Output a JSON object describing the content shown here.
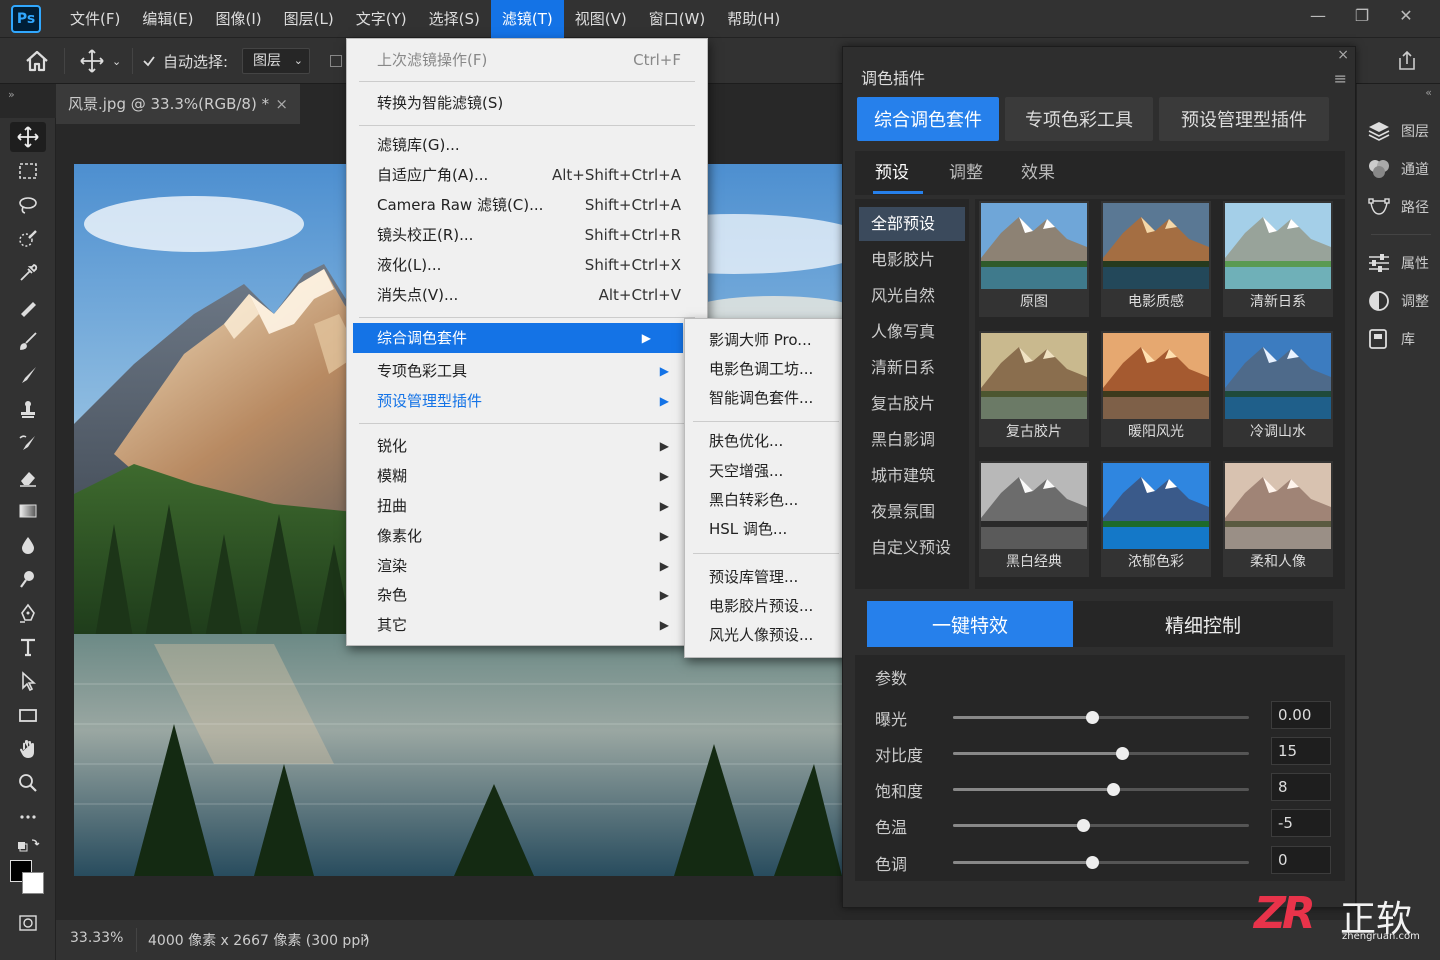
{
  "app": {
    "logo": "Ps"
  },
  "menubar": {
    "items": [
      "文件(F)",
      "编辑(E)",
      "图像(I)",
      "图层(L)",
      "文字(Y)",
      "选择(S)",
      "滤镜(T)",
      "视图(V)",
      "窗口(W)",
      "帮助(H)"
    ],
    "active_index": 6
  },
  "window_controls": {
    "minimize": "—",
    "restore": "❐",
    "close": "✕"
  },
  "optionsbar": {
    "auto_select_label": "自动选择:",
    "auto_select_checked": true,
    "target_value": "图层"
  },
  "document": {
    "tab_title": "风景.jpg @ 33.3%(RGB/8) *",
    "tab_close": "×"
  },
  "statusbar": {
    "zoom": "33.33%",
    "info": "4000 像素 x 2667 像素 (300 ppi)",
    "arrow": "›"
  },
  "filter_menu": {
    "last_filter": {
      "label": "上次滤镜操作(F)",
      "shortcut": "Ctrl+F"
    },
    "convert_smart": "转换为智能滤镜(S)",
    "group1": [
      {
        "label": "滤镜库(G)...",
        "shortcut": ""
      },
      {
        "label": "自适应广角(A)...",
        "shortcut": "Alt+Shift+Ctrl+A"
      },
      {
        "label": "Camera Raw 滤镜(C)...",
        "shortcut": "Shift+Ctrl+A"
      },
      {
        "label": "镜头校正(R)...",
        "shortcut": "Shift+Ctrl+R"
      },
      {
        "label": "液化(L)...",
        "shortcut": "Shift+Ctrl+X"
      },
      {
        "label": "消失点(V)...",
        "shortcut": "Alt+Ctrl+V"
      }
    ],
    "plugins": [
      "综合调色套件",
      "专项色彩工具",
      "预设管理型插件"
    ],
    "group3": [
      "锐化",
      "模糊",
      "扭曲",
      "像素化",
      "渲染",
      "杂色",
      "其它"
    ],
    "arrow": "▶"
  },
  "submenu": {
    "group1": [
      "影调大师 Pro...",
      "电影色调工坊...",
      "智能调色套件..."
    ],
    "group2": [
      "肤色优化...",
      "天空增强...",
      "黑白转彩色...",
      "HSL 调色..."
    ],
    "group3": [
      "预设库管理...",
      "电影胶片预设...",
      "风光人像预设..."
    ]
  },
  "panel": {
    "title": "调色插件",
    "close": "×",
    "menu_icon": "≡",
    "tabs": [
      "综合调色套件",
      "专项色彩工具",
      "预设管理型插件"
    ],
    "subtabs": [
      "预设",
      "调整",
      "效果"
    ],
    "categories": [
      "全部预设",
      "电影胶片",
      "风光自然",
      "人像写真",
      "清新日系",
      "复古胶片",
      "黑白影调",
      "城市建筑",
      "夜景氛围",
      "自定义预设"
    ],
    "presets": [
      "原图",
      "电影质感",
      "清新日系",
      "复古胶片",
      "暖阳风光",
      "冷调山水",
      "黑白经典",
      "浓郁色彩",
      "柔和人像"
    ],
    "modes": [
      "一键特效",
      "精细控制"
    ],
    "params_title": "参数",
    "params": [
      {
        "label": "曝光",
        "value": "0.00",
        "level": 0.47
      },
      {
        "label": "对比度",
        "value": "15",
        "level": 0.57
      },
      {
        "label": "饱和度",
        "value": "8",
        "level": 0.54
      },
      {
        "label": "色温",
        "value": "-5",
        "level": 0.44
      },
      {
        "label": "色调",
        "value": "0",
        "level": 0.47
      }
    ]
  },
  "dock": {
    "items": [
      "图层",
      "通道",
      "路径",
      "属性",
      "调整",
      "库"
    ]
  },
  "watermark": {
    "mark": "ZR",
    "brand": "正软",
    "url": "zhengruan.com"
  },
  "colors": {
    "accent": "#1473e6",
    "panel_accent": "#2680eb",
    "bg": "#282828",
    "chrome": "#323232"
  }
}
